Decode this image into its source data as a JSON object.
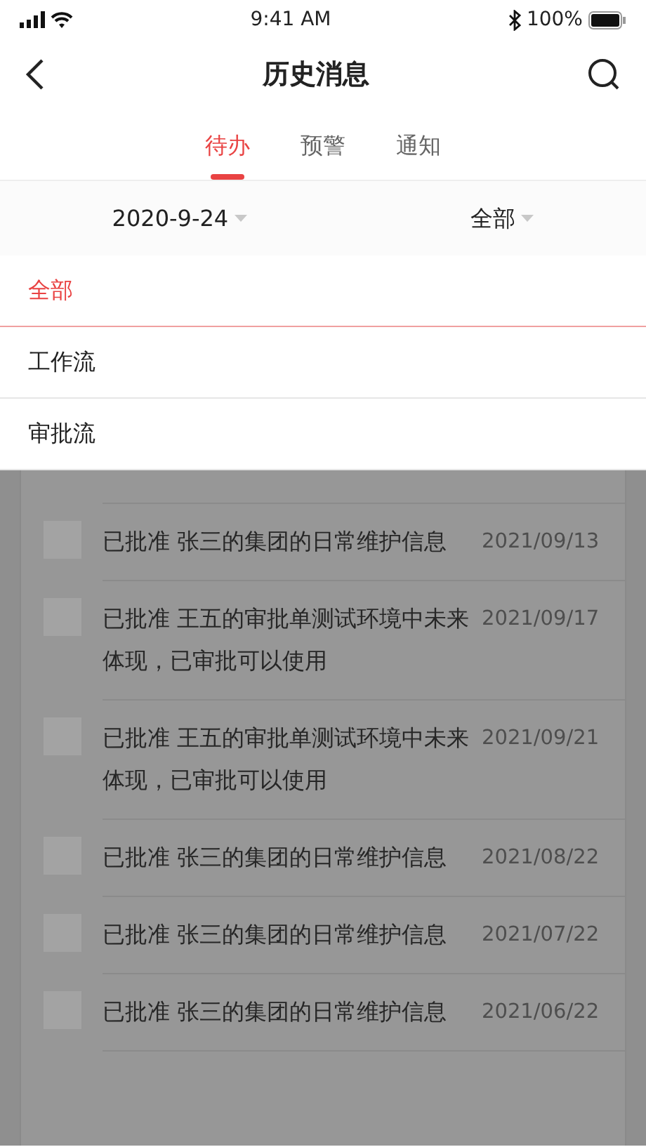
{
  "status_bar": {
    "time": "9:41 AM",
    "battery": "100%"
  },
  "nav": {
    "title": "历史消息"
  },
  "tabs": [
    {
      "label": "待办",
      "selected": true
    },
    {
      "label": "预警",
      "selected": false
    },
    {
      "label": "通知",
      "selected": false
    }
  ],
  "filters": [
    {
      "value": "2020-9-24"
    },
    {
      "value": "全部"
    }
  ],
  "menu": [
    {
      "label": "全部",
      "selected": true
    },
    {
      "label": "工作流",
      "selected": false
    },
    {
      "label": "审批流",
      "selected": false
    }
  ],
  "messages": [
    {
      "text": "已批准 张三的集团的日常维护信息",
      "date": "2021/09/13",
      "checked": false
    },
    {
      "text": "已批准 王五的审批单测试环境中未来体现，已审批可以使用",
      "date": "2021/09/17",
      "checked": false
    },
    {
      "text": "已批准 王五的审批单测试环境中未来体现，已审批可以使用",
      "date": "2021/09/21",
      "checked": false
    },
    {
      "text": "已批准 张三的集团的日常维护信息",
      "date": "2021/08/22",
      "checked": false
    },
    {
      "text": "已批准 张三的集团的日常维护信息",
      "date": "2021/07/22",
      "checked": false
    },
    {
      "text": "已批准 张三的集团的日常维护信息",
      "date": "2021/06/22",
      "checked": false
    }
  ]
}
